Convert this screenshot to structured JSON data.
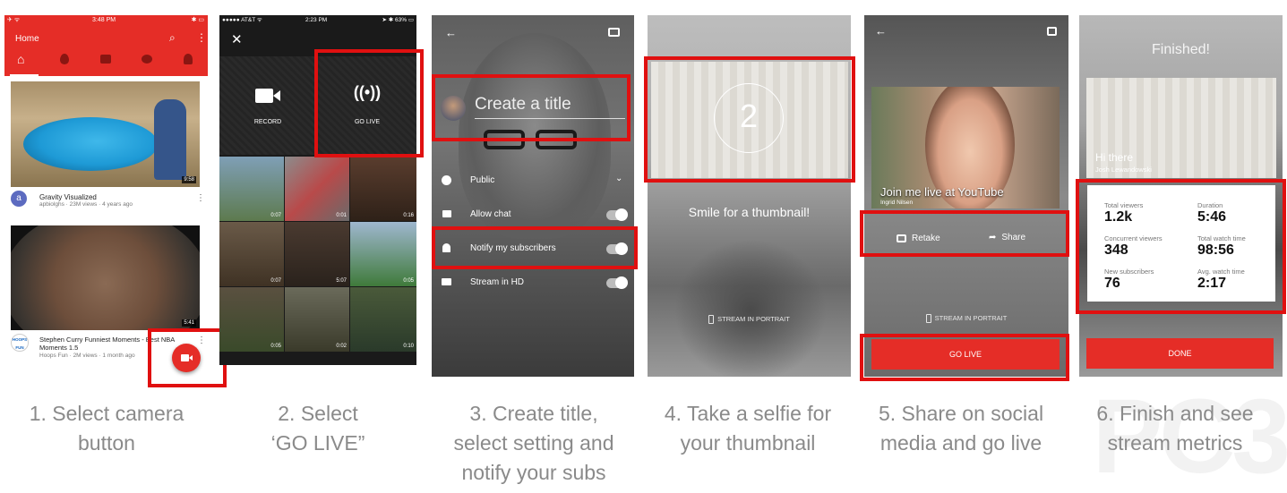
{
  "p1": {
    "status_left": "✈ ᯤ",
    "time": "3:48 PM",
    "status_right": "✱ ▭",
    "title": "Home",
    "videos": [
      {
        "title": "Gravity Visualized",
        "meta": "apbiolghs · 23M views · 4 years ago",
        "duration": "9:58",
        "avatar": "a"
      },
      {
        "title": "Stephen Curry Funniest Moments - Best NBA Moments 1.5",
        "meta": "Hoops Fun · 2M views · 1 month ago",
        "duration": "5:41",
        "avatar": "HOOPS FUN"
      }
    ]
  },
  "p2": {
    "status_left": "●●●●● AT&T ᯤ",
    "time": "2:23 PM",
    "status_right": "➤ ✱ 63% ▭",
    "record_label": "RECORD",
    "golive_label": "GO LIVE",
    "durations": [
      "0:07",
      "0:01",
      "0:16",
      "0:07",
      "5:07",
      "0:05",
      "0:05",
      "0:02",
      "0:10"
    ]
  },
  "p3": {
    "title_placeholder": "Create a title",
    "settings": [
      "Public",
      "Allow chat",
      "Notify my subscribers",
      "Stream in HD"
    ]
  },
  "p4": {
    "countdown": "2",
    "prompt": "Smile for a thumbnail!",
    "portrait": "STREAM IN PORTRAIT"
  },
  "p5": {
    "banner_title": "Join me live at YouTube",
    "banner_sub": "Ingrid Nilsen",
    "retake": "Retake",
    "share": "Share",
    "portrait": "STREAM IN PORTRAIT",
    "golive": "GO LIVE"
  },
  "p6": {
    "finished": "Finished!",
    "hi": "Hi there",
    "user": "Josh Lewandowski",
    "metrics": [
      {
        "label": "Total viewers",
        "value": "1.2k"
      },
      {
        "label": "Duration",
        "value": "5:46"
      },
      {
        "label": "Concurrent viewers",
        "value": "348"
      },
      {
        "label": "Total watch time",
        "value": "98:56"
      },
      {
        "label": "New subscribers",
        "value": "76"
      },
      {
        "label": "Avg. watch time",
        "value": "2:17"
      }
    ],
    "done": "DONE"
  },
  "captions": [
    "1. Select camera\nbutton",
    "2. Select\n‘GO LIVE”",
    "3. Create title,\nselect setting and\nnotify your subs",
    "4. Take a selfie for\nyour thumbnail",
    "5. Share on social\nmedia and go live",
    "6. Finish and see\nstream metrics"
  ],
  "watermark": "PC3",
  "colors": {
    "youtube_red": "#e52d27",
    "highlight": "#e01010",
    "caption": "#8a8a8a"
  }
}
